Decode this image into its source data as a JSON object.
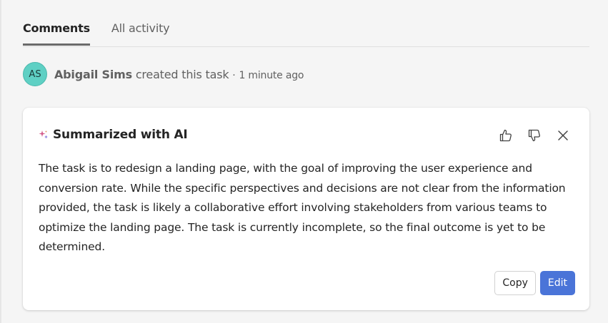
{
  "tabs": [
    {
      "label": "Comments",
      "active": true
    },
    {
      "label": "All activity",
      "active": false
    }
  ],
  "activity": {
    "avatar_initials": "AS",
    "avatar_color": "#5fd0c4",
    "user_name": "Abigail Sims",
    "action": "created this task",
    "separator": "·",
    "time": "1 minute ago"
  },
  "summary_card": {
    "icon": "sparkle-icon",
    "title": "Summarized with AI",
    "actions": [
      "thumbs-up-icon",
      "thumbs-down-icon",
      "close-icon"
    ],
    "body": "The task is to redesign a landing page, with the goal of improving the user experience and conversion rate. While the specific perspectives and decisions are not clear from the information provided, the task is likely a collaborative effort involving stakeholders from various teams to optimize the landing page. The task is currently incomplete, so the final outcome is yet to be determined.",
    "copy_label": "Copy",
    "edit_label": "Edit",
    "accent_color": "#4a74d8"
  }
}
